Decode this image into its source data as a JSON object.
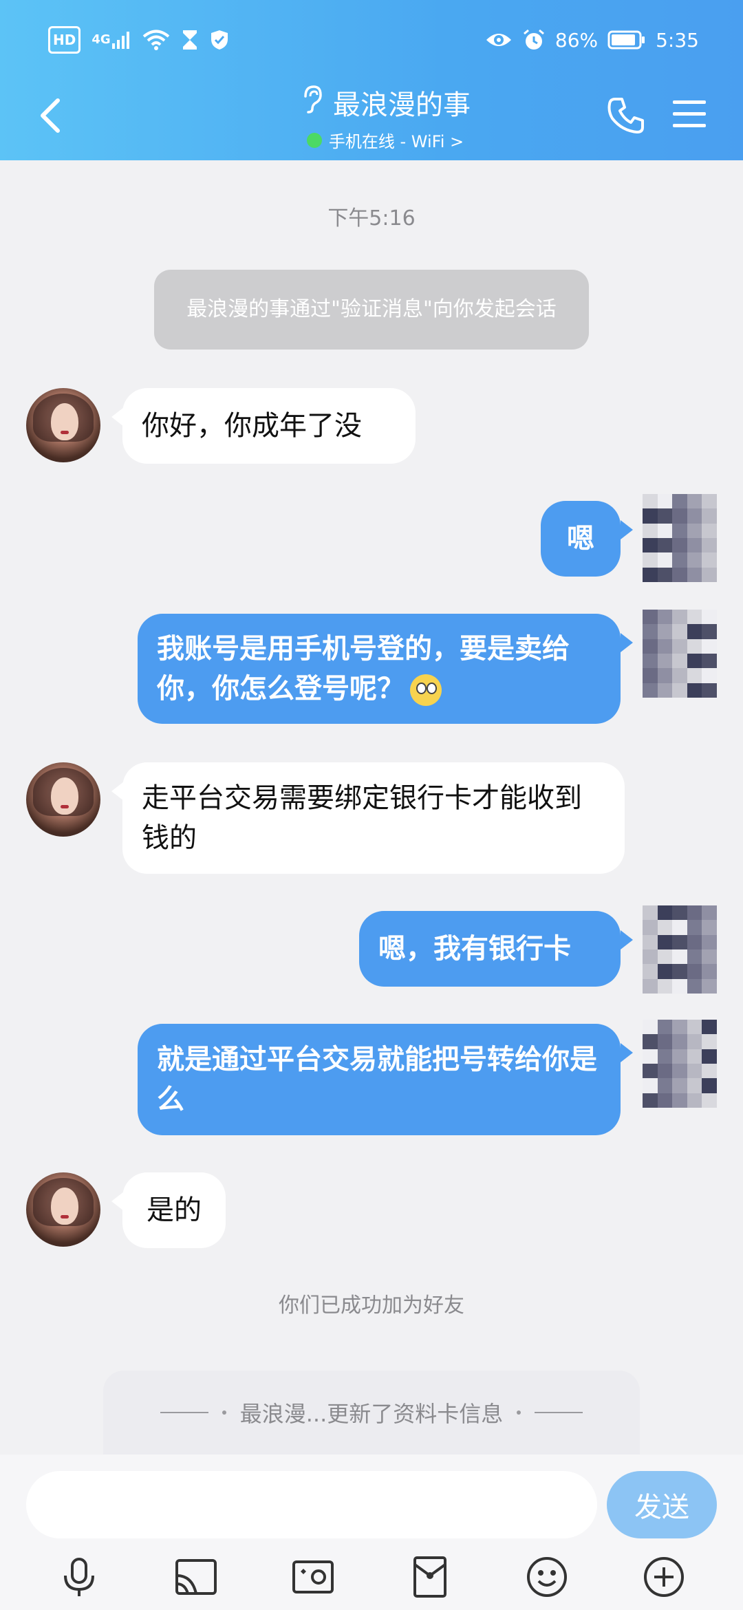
{
  "status_bar": {
    "left_badge": "HD",
    "network": "4G",
    "battery": "86%",
    "time": "5:35"
  },
  "header": {
    "title": "最浪漫的事",
    "subtitle": "手机在线 - WiFi >"
  },
  "chat": {
    "timestamp": "下午5:16",
    "system_message": "最浪漫的事通过\"验证消息\"向你发起会话",
    "messages": [
      {
        "side": "in",
        "text": "你好，你成年了没"
      },
      {
        "side": "out",
        "text": "嗯"
      },
      {
        "side": "out",
        "text": "我账号是用手机号登的，要是卖给你，你怎么登号呢？"
      },
      {
        "side": "in",
        "text": "走平台交易需要绑定银行卡才能收到钱的"
      },
      {
        "side": "out",
        "text": "嗯，我有银行卡"
      },
      {
        "side": "out",
        "text": "就是通过平台交易就能把号转给你是么"
      },
      {
        "side": "in",
        "text": "是的"
      }
    ],
    "friend_note": "你们已成功加为好友",
    "profile_update": "最浪漫...更新了资料卡信息"
  },
  "input": {
    "value": "",
    "placeholder": "",
    "send_label": "发送"
  },
  "toolbar_icons": [
    "microphone-icon",
    "screen-cast-icon",
    "photo-icon",
    "red-packet-icon",
    "emoji-icon",
    "plus-icon"
  ],
  "colors": {
    "header_start": "#5cc3f6",
    "header_end": "#4a9ff0",
    "out_bubble": "#4d9cf0",
    "in_bubble": "#ffffff",
    "send_button": "#8cc4f4"
  }
}
